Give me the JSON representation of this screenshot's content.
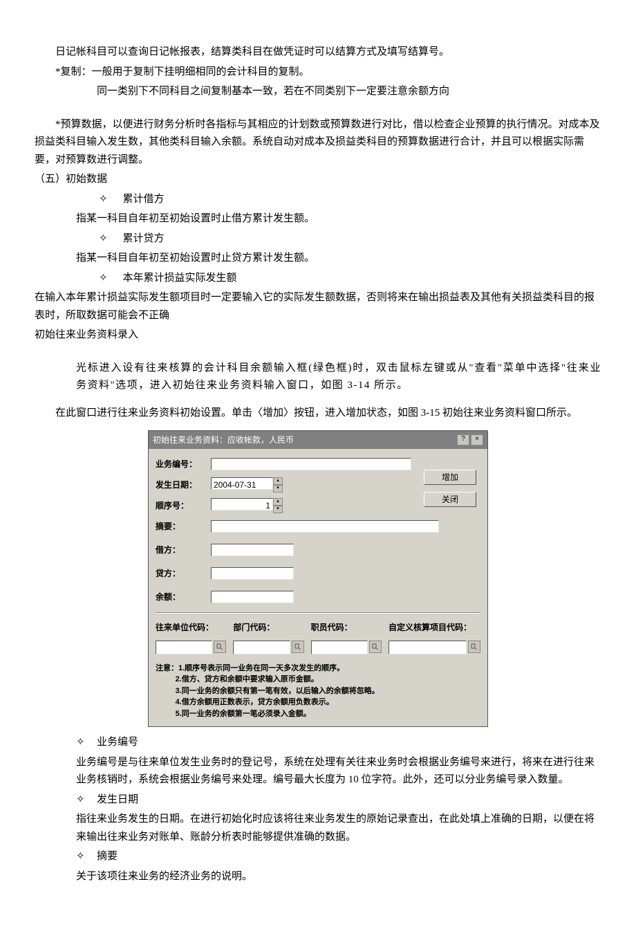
{
  "p1": "日记帐科目可以查询日记帐报表，结算类科目在做凭证时可以结算方式及填写结算号。",
  "p2": "*复制：一般用于复制下挂明细相同的会计科目的复制。",
  "p3": "同一类别下不同科目之间复制基本一致，若在不同类别下一定要注意余额方向",
  "p4": "*预算数据，以便进行财务分析时各指标与其相应的计划数或预算数进行对比，借以检查企业预算的执行情况。对成本及损益类科目输入发生数，其他类科目输入余额。系统自动对成本及损益类科目的预算数据进行合计，并且可以根据实际需要，对预算数进行调整。",
  "h5": "（五）初始数据",
  "b1": "累计借方",
  "d1": "指某一科目自年初至初始设置时止借方累计发生额。",
  "b2": "累计贷方",
  "d2": "指某一科目自年初至初始设置时止贷方累计发生额。",
  "b3": "本年累计损益实际发生额",
  "d3": "在输入本年累计损益实际发生额项目时一定要输入它的实际发生额数据，否则将来在输出损益表及其他有关损益类科目的报表时，所取数据可能会不正确",
  "h6": "初始往来业务资料录入",
  "p5": "光标进入设有往来核算的会计科目余额输入框(绿色框)时，双击鼠标左键或从\"查看\"菜单中选择\"往来业务资料\"选项，进入初始往来业务资料输入窗口，如图 3-14 所示。",
  "p6": "在此窗口进行往来业务资料初始设置。单击〈增加〉按钮，进入增加状态，如图 3-15 初始往来业务资料窗口所示。",
  "dialog": {
    "title": "初始往来业务资料：应收帐款，人民币",
    "labels": {
      "biz_no": "业务编号：",
      "date": "发生日期：",
      "seq": "顺序号：",
      "summary": "摘要：",
      "debit": "借方：",
      "credit": "贷方：",
      "balance": "余额：",
      "unit_code": "往来单位代码：",
      "dept_code": "部门代码：",
      "emp_code": "职员代码：",
      "custom_code": "自定义核算项目代码："
    },
    "values": {
      "date": "2004-07-31",
      "seq": "1"
    },
    "buttons": {
      "add": "增加",
      "close": "关闭"
    },
    "notes": {
      "prefix": "注意：",
      "n1": "1.顺序号表示同一业务在同一天多次发生的顺序。",
      "n2": "2.借方、贷方和余额中要求输入原币金额。",
      "n3": "3.同一业务的余额只有第一笔有效，以后输入的余额将忽略。",
      "n4": "4.借方余额用正数表示，贷方余额用负数表示。",
      "n5": "5.同一业务的余额第一笔必须录入金额。"
    }
  },
  "b4": "业务编号",
  "d4": "业务编号是与往来单位发生业务时的登记号，系统在处理有关往来业务时会根据业务编号来进行，将来在进行往来业务核销时，系统会根据业务编号来处理。编号最大长度为 10 位字符。此外，还可以分业务编号录入数量。",
  "b5": "发生日期",
  "d5": "指往来业务发生的日期。在进行初始化时应该将往来业务发生的原始记录查出，在此处填上准确的日期，以便在将来输出往来业务对账单、账龄分析表时能够提供准确的数据。",
  "b6": "摘要",
  "d6": "关于该项往来业务的经济业务的说明。"
}
